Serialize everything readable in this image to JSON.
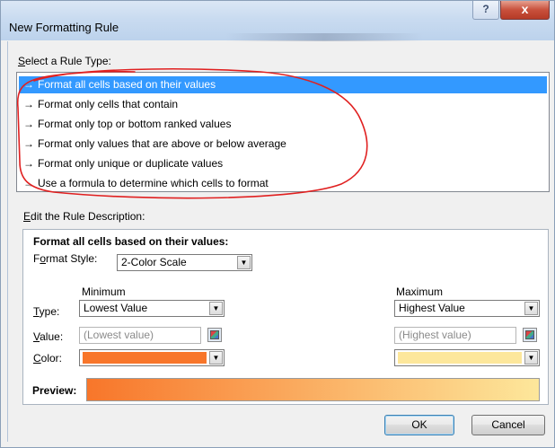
{
  "window": {
    "title": "New Formatting Rule",
    "help_label": "?",
    "close_label": "x"
  },
  "rule_type": {
    "label": "Select a Rule Type:",
    "items": [
      "Format all cells based on their values",
      "Format only cells that contain",
      "Format only top or bottom ranked values",
      "Format only values that are above or below average",
      "Format only unique or duplicate values",
      "Use a formula to determine which cells to format"
    ],
    "selected_index": 0
  },
  "rule_description": {
    "label": "Edit the Rule Description:",
    "heading": "Format all cells based on their values:",
    "format_style_label": "Format Style:",
    "format_style_value": "2-Color Scale",
    "minimum_label": "Minimum",
    "maximum_label": "Maximum",
    "type_label": "Type:",
    "value_label": "Value:",
    "color_label": "Color:",
    "min_type": "Lowest Value",
    "max_type": "Highest Value",
    "min_value_placeholder": "(Lowest value)",
    "max_value_placeholder": "(Highest value)",
    "min_color": "#f8762a",
    "max_color": "#fde79b",
    "preview_label": "Preview:"
  },
  "buttons": {
    "ok": "OK",
    "cancel": "Cancel"
  },
  "icons": {
    "rule_item": "arrow-right-icon",
    "dropdown": "chevron-down-icon",
    "picker": "range-picker-icon"
  },
  "colors": {
    "selection": "#3399ff",
    "annotation_circle": "#e02020"
  }
}
